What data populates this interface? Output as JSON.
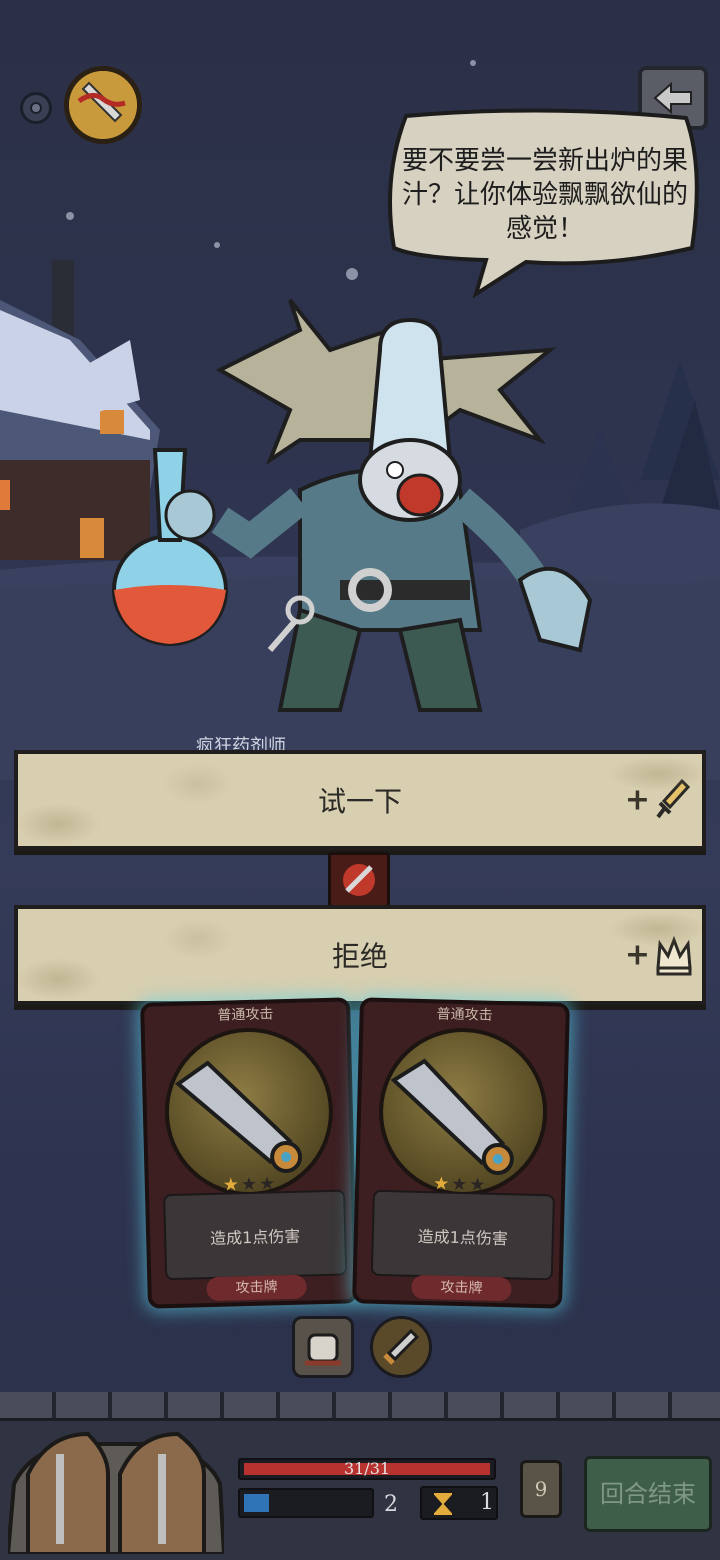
{
  "dialogue": {
    "speech": "要不要尝一尝新出炉的果汁？让你体验飘飘欲仙的感觉！",
    "npc_name": "疯狂药剂师"
  },
  "options": [
    {
      "label": "试一下",
      "reward_prefix": "+",
      "reward_icon": "sword-icon"
    },
    {
      "label": "拒绝",
      "reward_prefix": "+",
      "reward_icon": "crown-icon"
    }
  ],
  "cards": [
    {
      "title": "普通攻击",
      "stars": 1,
      "max_stars": 3,
      "description": "造成1点伤害",
      "type": "攻击牌"
    },
    {
      "title": "普通攻击",
      "stars": 1,
      "max_stars": 3,
      "description": "造成1点伤害",
      "type": "攻击牌"
    }
  ],
  "status": {
    "hp_text": "31/31",
    "hp_fraction": 1.0,
    "energy_fraction": 0.2,
    "energy_count": "2",
    "turn_count": "1",
    "deck_count": "9",
    "end_turn_label": "回合结束"
  },
  "colors": {
    "hp": "#b8322f",
    "energy": "#2e74b7",
    "card_glow": "#5ad2e6",
    "banner": "#d8cfb0"
  }
}
